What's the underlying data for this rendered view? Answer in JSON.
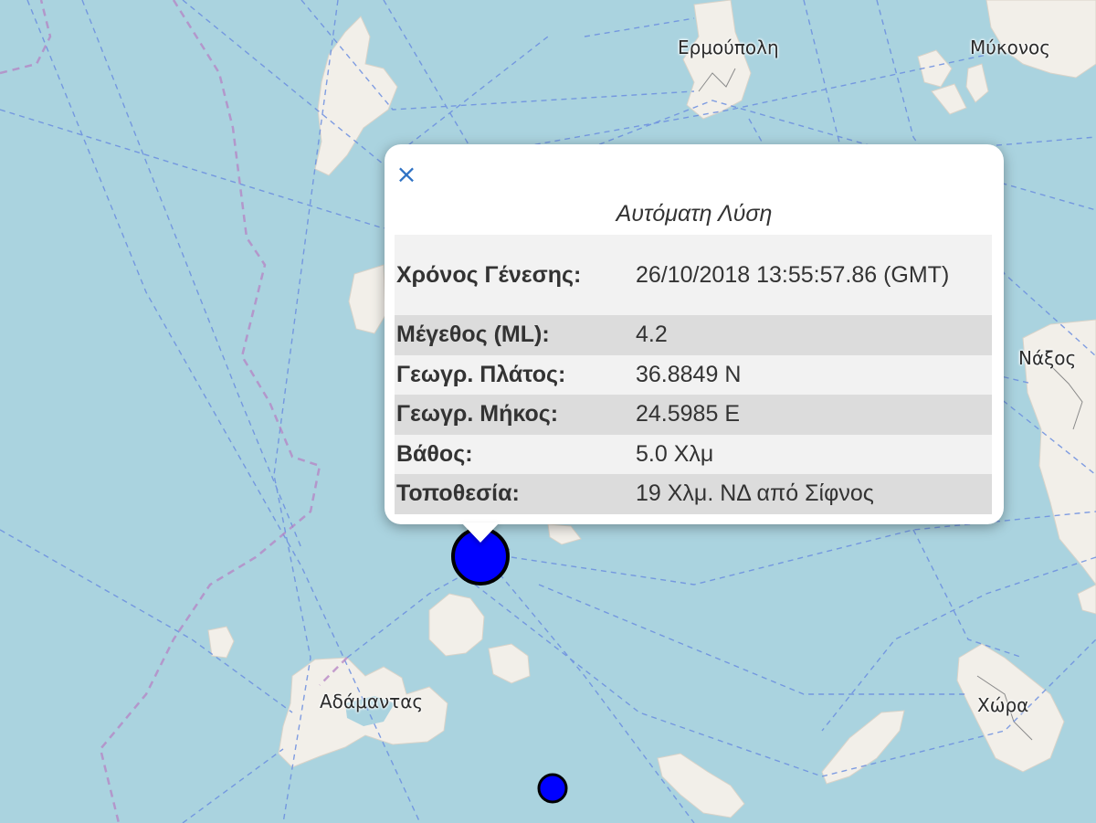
{
  "colors": {
    "sea": "#aad3df",
    "land": "#f2efe9",
    "route": "#6b8ee0",
    "boundary": "#b583c4",
    "marker_fill": "#0000ff",
    "close_x": "#2f72c4"
  },
  "map": {
    "labels": {
      "ermoupoli": "Ερμούπολη",
      "mykonos": "Μύκονος",
      "naxos": "Νάξος",
      "adamantas": "Αδάμαντας",
      "chora": "Χώρα"
    }
  },
  "popup": {
    "close_symbol": "×",
    "title": "Αυτόματη Λύση",
    "rows": [
      {
        "label": "Χρόνος Γένεσης:",
        "value": "26/10/2018 13:55:57.86 (GMT)"
      },
      {
        "label": "Μέγεθος (ML):",
        "value": "4.2"
      },
      {
        "label": "Γεωγρ. Πλάτος:",
        "value": "36.8849 N"
      },
      {
        "label": "Γεωγρ. Μήκος:",
        "value": "24.5985 E"
      },
      {
        "label": "Βάθος:",
        "value": "5.0 Χλμ"
      },
      {
        "label": "Τοποθεσία:",
        "value": "19 Χλμ. ΝΔ από Σίφνος"
      }
    ]
  }
}
